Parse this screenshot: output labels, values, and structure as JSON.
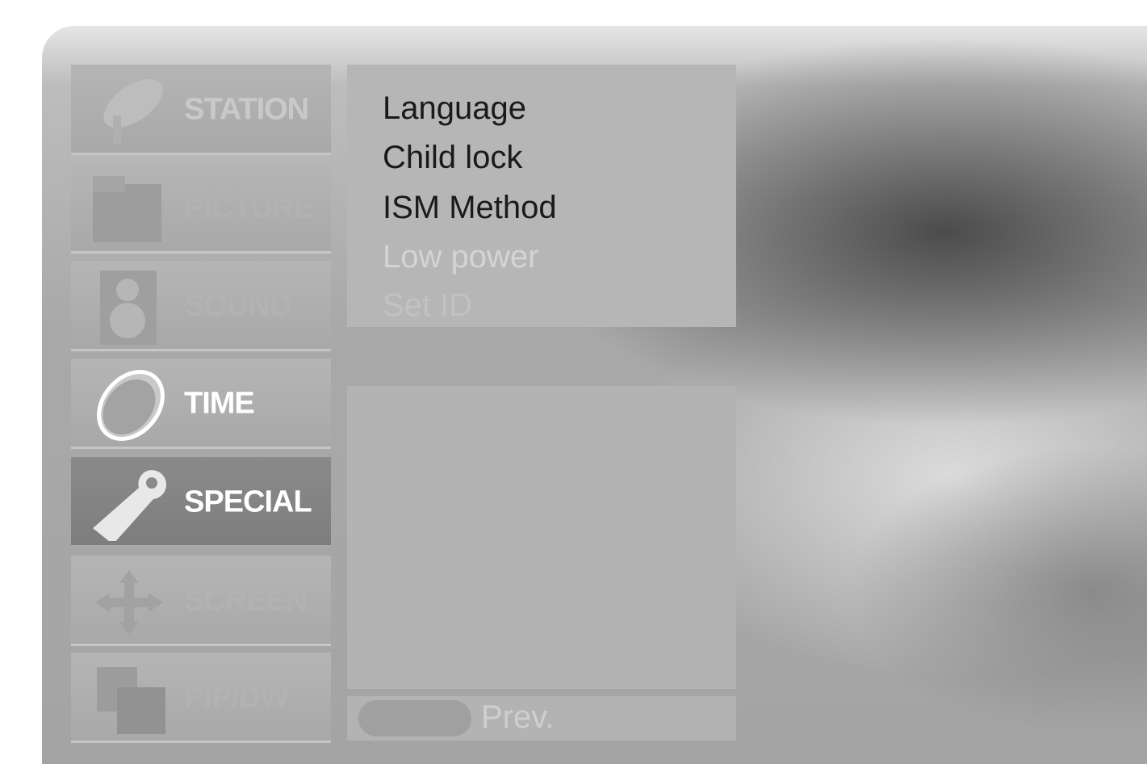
{
  "menu": {
    "items": [
      {
        "label": "STATION",
        "icon": "satellite-dish-icon",
        "state": "normal"
      },
      {
        "label": "PICTURE",
        "icon": "picture-icon",
        "state": "dim"
      },
      {
        "label": "SOUND",
        "icon": "speaker-icon",
        "state": "dim"
      },
      {
        "label": "TIME",
        "icon": "clock-icon",
        "state": "normal"
      },
      {
        "label": "SPECIAL",
        "icon": "special-tag-icon",
        "state": "selected"
      },
      {
        "label": "SCREEN",
        "icon": "screen-arrows-icon",
        "state": "dim"
      },
      {
        "label": "PIP/DW",
        "icon": "pip-icon",
        "state": "dim"
      }
    ]
  },
  "submenu": {
    "options": [
      "Language",
      "Child lock",
      "ISM Method",
      "Low power",
      "Set ID"
    ]
  },
  "footer": {
    "prev_label": "Prev."
  }
}
